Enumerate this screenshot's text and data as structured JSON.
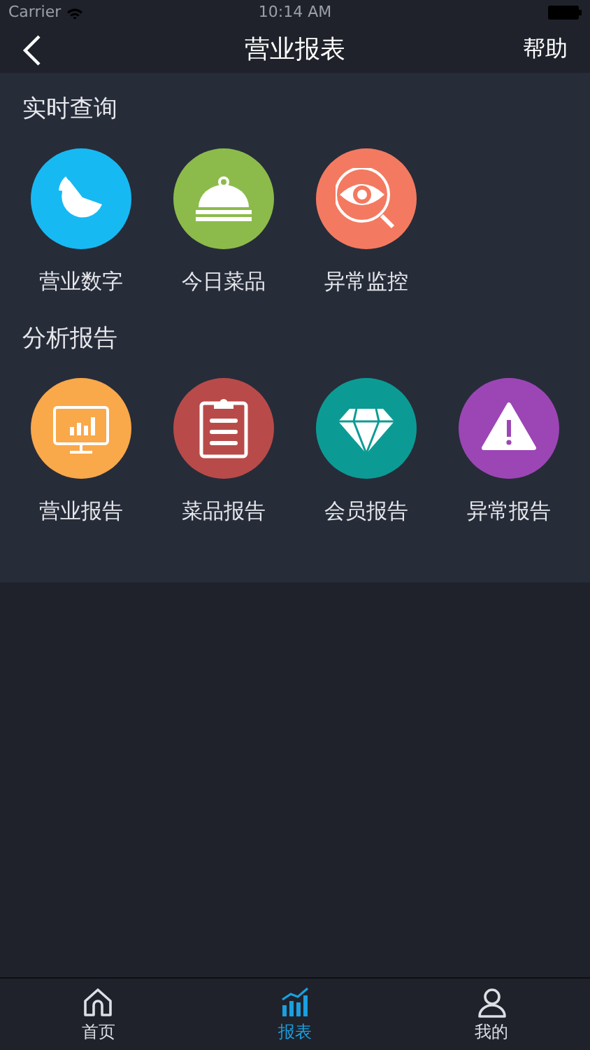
{
  "status_bar": {
    "carrier": "Carrier",
    "time": "10:14 AM"
  },
  "nav": {
    "title": "营业报表",
    "action": "帮助"
  },
  "sections": [
    {
      "title": "实时查询",
      "items": [
        {
          "label": "营业数字",
          "kind": "pie",
          "color": "#17b9f3"
        },
        {
          "label": "今日菜品",
          "kind": "cloche",
          "color": "#8cbb4b"
        },
        {
          "label": "异常监控",
          "kind": "eye",
          "color": "#f37a60"
        }
      ]
    },
    {
      "title": "分析报告",
      "items": [
        {
          "label": "营业报告",
          "kind": "monitor",
          "color": "#f9a84a"
        },
        {
          "label": "菜品报告",
          "kind": "clipboard",
          "color": "#b84b49"
        },
        {
          "label": "会员报告",
          "kind": "diamond",
          "color": "#0c9b94"
        },
        {
          "label": "异常报告",
          "kind": "warning",
          "color": "#9c46b5"
        }
      ]
    }
  ],
  "tabs": [
    {
      "label": "首页",
      "kind": "home",
      "selected": false
    },
    {
      "label": "报表",
      "kind": "chart",
      "selected": true
    },
    {
      "label": "我的",
      "kind": "person",
      "selected": false
    }
  ]
}
